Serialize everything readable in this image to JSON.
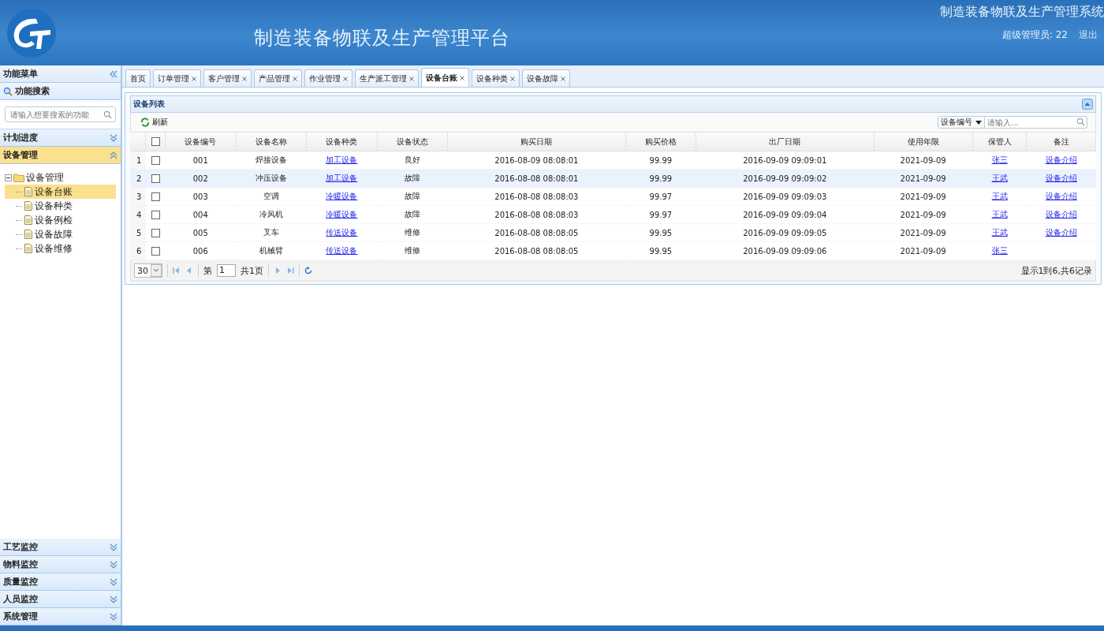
{
  "header": {
    "title": "制造装备物联及生产管理平台",
    "system_name": "制造装备物联及生产管理系统",
    "user": "超级管理员: 22",
    "logout": "退出"
  },
  "sidebar": {
    "title": "功能菜单",
    "search_title": "功能搜索",
    "search_placeholder": "请输入想要搜索的功能",
    "sections_top": [
      {
        "label": "计划进度",
        "expanded": false
      },
      {
        "label": "设备管理",
        "expanded": true
      }
    ],
    "tree": {
      "label": "设备管理",
      "children": [
        {
          "label": "设备台账",
          "selected": true
        },
        {
          "label": "设备种类",
          "selected": false
        },
        {
          "label": "设备例检",
          "selected": false
        },
        {
          "label": "设备故障",
          "selected": false
        },
        {
          "label": "设备维修",
          "selected": false
        }
      ]
    },
    "sections_bottom": [
      {
        "label": "工艺监控",
        "expanded": false
      },
      {
        "label": "物料监控",
        "expanded": false
      },
      {
        "label": "质量监控",
        "expanded": false
      },
      {
        "label": "人员监控",
        "expanded": false
      },
      {
        "label": "系统管理",
        "expanded": false
      }
    ]
  },
  "tabs": [
    {
      "label": "首页",
      "closable": false,
      "selected": false
    },
    {
      "label": "订单管理",
      "closable": true,
      "selected": false
    },
    {
      "label": "客户管理",
      "closable": true,
      "selected": false
    },
    {
      "label": "产品管理",
      "closable": true,
      "selected": false
    },
    {
      "label": "作业管理",
      "closable": true,
      "selected": false
    },
    {
      "label": "生产派工管理",
      "closable": true,
      "selected": false
    },
    {
      "label": "设备台账",
      "closable": true,
      "selected": true
    },
    {
      "label": "设备种类",
      "closable": true,
      "selected": false
    },
    {
      "label": "设备故障",
      "closable": true,
      "selected": false
    }
  ],
  "panel": {
    "title": "设备列表",
    "refresh": "刷新",
    "filter_field": "设备编号",
    "filter_placeholder": "请输入..."
  },
  "table": {
    "header_checked": false,
    "columns": [
      {
        "label": "设备编号",
        "kind": "text"
      },
      {
        "label": "设备名称",
        "kind": "text"
      },
      {
        "label": "设备种类",
        "kind": "link"
      },
      {
        "label": "设备状态",
        "kind": "text"
      },
      {
        "label": "购买日期",
        "kind": "text"
      },
      {
        "label": "购买价格",
        "kind": "text"
      },
      {
        "label": "出厂日期",
        "kind": "text"
      },
      {
        "label": "使用年限",
        "kind": "text"
      },
      {
        "label": "保管人",
        "kind": "link"
      },
      {
        "label": "备注",
        "kind": "link"
      }
    ],
    "rows": [
      {
        "num": "1",
        "checked": false,
        "selected": false,
        "cells": [
          "001",
          "焊接设备",
          "加工设备",
          "良好",
          "2016-08-09 08:08:01",
          "99.99",
          "2016-09-09 09:09:01",
          "2021-09-09",
          "张三",
          "设备介绍"
        ]
      },
      {
        "num": "2",
        "checked": false,
        "selected": true,
        "cells": [
          "002",
          "冲压设备",
          "加工设备",
          "故障",
          "2016-08-08 08:08:01",
          "99.99",
          "2016-09-09 09:09:02",
          "2021-09-09",
          "王武",
          "设备介绍"
        ]
      },
      {
        "num": "3",
        "checked": false,
        "selected": false,
        "cells": [
          "003",
          "空调",
          "冷暖设备",
          "故障",
          "2016-08-08 08:08:03",
          "99.97",
          "2016-09-09 09:09:03",
          "2021-09-09",
          "王武",
          "设备介绍"
        ]
      },
      {
        "num": "4",
        "checked": false,
        "selected": false,
        "cells": [
          "004",
          "冷风机",
          "冷暖设备",
          "故障",
          "2016-08-08 08:08:03",
          "99.97",
          "2016-09-09 09:09:04",
          "2021-09-09",
          "王武",
          "设备介绍"
        ]
      },
      {
        "num": "5",
        "checked": false,
        "selected": false,
        "cells": [
          "005",
          "叉车",
          "传送设备",
          "维修",
          "2016-08-08 08:08:05",
          "99.95",
          "2016-09-09 09:09:05",
          "2021-09-09",
          "王武",
          "设备介绍"
        ]
      },
      {
        "num": "6",
        "checked": false,
        "selected": false,
        "cells": [
          "006",
          "机械臂",
          "传送设备",
          "维修",
          "2016-08-08 08:08:05",
          "99.95",
          "2016-09-09 09:09:06",
          "2021-09-09",
          "张三"
        ]
      }
    ]
  },
  "pager": {
    "page_size": "30",
    "page_prefix": "第",
    "page": "1",
    "page_total": "共1页",
    "summary": "显示1到6,共6记录"
  }
}
